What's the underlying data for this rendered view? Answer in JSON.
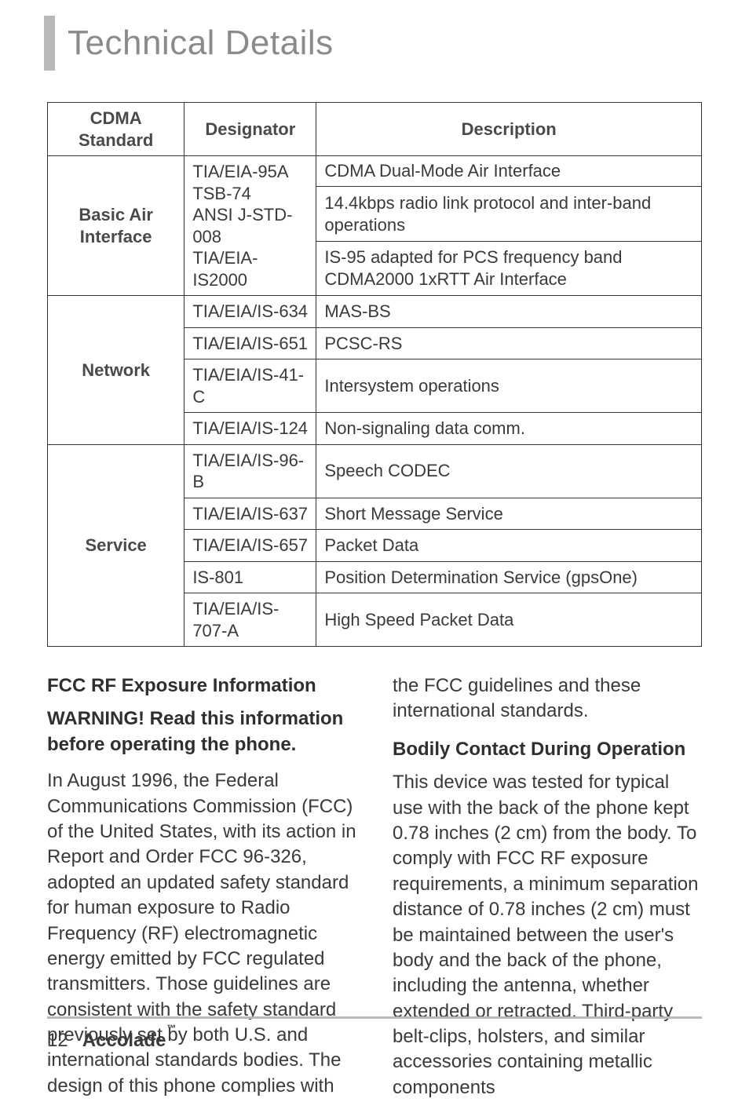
{
  "section_title": "Technical Details",
  "table": {
    "headers": [
      "CDMA Standard",
      "Designator",
      "Description"
    ],
    "groups": [
      {
        "label": "Basic Air Interface",
        "designators": [
          "TIA/EIA-95A",
          "TSB-74",
          "ANSI J-STD-008",
          "TIA/EIA-IS2000"
        ],
        "descriptions": [
          "CDMA Dual-Mode Air Interface",
          "14.4kbps radio link protocol and inter-band operations",
          "IS-95 adapted for PCS frequency band CDMA2000 1xRTT Air Interface"
        ]
      },
      {
        "label": "Network",
        "rows": [
          {
            "designator": "TIA/EIA/IS-634",
            "description": "MAS-BS"
          },
          {
            "designator": "TIA/EIA/IS-651",
            "description": "PCSC-RS"
          },
          {
            "designator": "TIA/EIA/IS-41-C",
            "description": "Intersystem operations"
          },
          {
            "designator": "TIA/EIA/IS-124",
            "description": "Non-signaling data comm."
          }
        ]
      },
      {
        "label": "Service",
        "rows": [
          {
            "designator": "TIA/EIA/IS-96-B",
            "description": "Speech CODEC"
          },
          {
            "designator": "TIA/EIA/IS-637",
            "description": "Short Message Service"
          },
          {
            "designator": "TIA/EIA/IS-657",
            "description": "Packet Data"
          },
          {
            "designator": "IS-801",
            "description": "Position Determination Service (gpsOne)"
          },
          {
            "designator": "TIA/EIA/IS-707-A",
            "description": "High Speed Packet Data"
          }
        ]
      }
    ]
  },
  "left": {
    "h1": "FCC RF Exposure Information",
    "h2": "WARNING! Read this information before operating the phone.",
    "p1": "In August 1996, the Federal Communications Commission (FCC) of the United States, with its action in Report and Order FCC 96-326, adopted an updated safety standard for human exposure to Radio Frequency (RF) electromagnetic energy emitted by FCC regulated transmitters. Those guidelines are consistent with the safety standard previously set by both U.S. and international standards bodies. The design of this phone complies with"
  },
  "right": {
    "cont": "the FCC guidelines and these international standards.",
    "h3": "Bodily Contact During Operation",
    "p2": "This device was tested for typical use with the back of the phone kept 0.78 inches (2 cm) from the body. To comply with FCC RF exposure requirements, a minimum separation distance of 0.78 inches (2 cm) must be maintained between the user's body and the back of the phone, including the antenna, whether extended or retracted. Third-party belt-clips, holsters, and similar accessories containing metallic components"
  },
  "footer": {
    "page": "12",
    "brand": "Accolade",
    "tm": "™"
  }
}
